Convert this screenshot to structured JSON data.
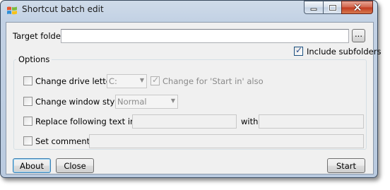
{
  "window": {
    "title": "Shortcut batch edit",
    "buttons": {
      "minimize": "minimize",
      "maximize": "maximize",
      "close": "close"
    }
  },
  "target": {
    "label": "Target folder:",
    "value": "",
    "browse_label": "..."
  },
  "include_subfolders": {
    "label": "Include subfolders",
    "checked": true
  },
  "options": {
    "group_label": "Options",
    "change_drive": {
      "label": "Change drive letter to",
      "checked": false,
      "value": "C:",
      "start_in_label": "Change for 'Start in' also",
      "start_in_checked": true
    },
    "window_style": {
      "label": "Change window style to",
      "checked": false,
      "value": "Normal"
    },
    "replace": {
      "label": "Replace following text in path",
      "checked": false,
      "find_value": "",
      "with_label": "with",
      "replace_value": ""
    },
    "comment": {
      "label": "Set comment to",
      "checked": false,
      "value": ""
    }
  },
  "footer": {
    "about_label": "About",
    "close_label": "Close",
    "start_label": "Start"
  }
}
